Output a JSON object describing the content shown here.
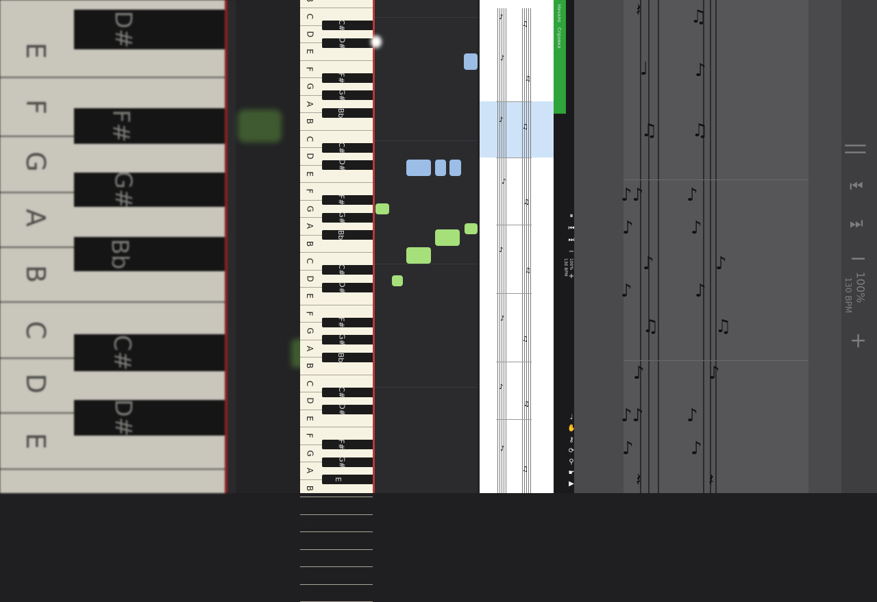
{
  "app": {
    "title": "Piano tutorial view"
  },
  "left_keys": {
    "white": [
      "E",
      "F",
      "G",
      "A",
      "B",
      "C",
      "D",
      "E"
    ],
    "black": [
      "D#",
      "F#",
      "G#",
      "Bb",
      "C#",
      "D#"
    ]
  },
  "keyboard": {
    "white": [
      "B",
      "C",
      "D",
      "E",
      "F",
      "G",
      "A",
      "B",
      "C",
      "D",
      "E",
      "F",
      "G",
      "A",
      "B",
      "C",
      "D",
      "E",
      "F",
      "G",
      "A",
      "B",
      "C",
      "D",
      "E",
      "F",
      "G",
      "A",
      "B",
      "C",
      "D",
      "E",
      "F",
      "G",
      "A"
    ],
    "black": [
      "Bb",
      "C#",
      "D#",
      "F#",
      "G#",
      "Bb",
      "C#",
      "D#",
      "F#",
      "G#",
      "Bb",
      "C#",
      "D#",
      "F#",
      "G#",
      "Bb",
      "C#",
      "D#",
      "F#",
      "G#",
      "E"
    ]
  },
  "sidebar": {
    "tab_start": "Начало",
    "tab_help": "Справка"
  },
  "transport": {
    "zoom": "100%",
    "tempo": "130 BPM",
    "pause_icon": "pause-icon",
    "prev_icon": "skip-back-icon",
    "next_icon": "skip-forward-icon",
    "minus_icon": "minus-icon",
    "plus_icon": "plus-icon"
  },
  "big_controls": {
    "zoom": "100%",
    "tempo": "130 BPM",
    "pause": "||",
    "minus": "−",
    "plus": "+"
  },
  "tools": [
    "metronome-icon",
    "hand-icon",
    "key-icon",
    "loop-icon",
    "pin-icon",
    "hand-right-icon",
    "play-icon"
  ],
  "colors": {
    "right_hand": "#a6e07a",
    "left_hand": "#9bbde6",
    "accent_green": "#2ea43a",
    "keyboard_edge": "#b83a3a"
  }
}
